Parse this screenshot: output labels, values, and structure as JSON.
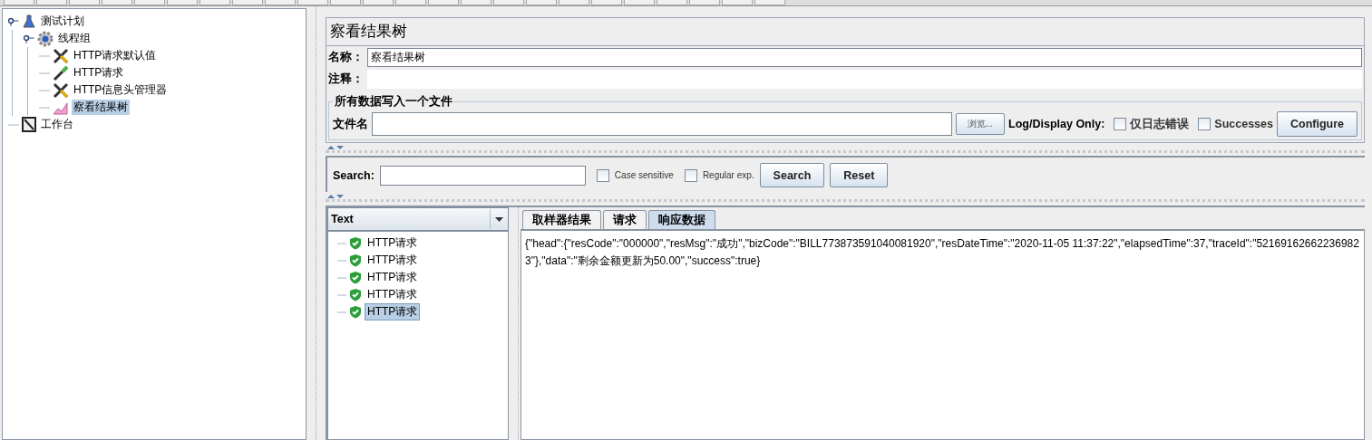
{
  "tree": [
    {
      "label": "测试计划",
      "kind": "plan",
      "selected": false,
      "children": [
        {
          "label": "线程组",
          "kind": "threads",
          "selected": false,
          "children": [
            {
              "label": "HTTP请求默认值",
              "kind": "config",
              "selected": false
            },
            {
              "label": "HTTP请求",
              "kind": "sampler",
              "selected": false
            },
            {
              "label": "HTTP信息头管理器",
              "kind": "config",
              "selected": false
            },
            {
              "label": "察看结果树",
              "kind": "listener",
              "selected": true
            }
          ]
        }
      ]
    },
    {
      "label": "工作台",
      "kind": "workbench",
      "selected": false
    }
  ],
  "panel": {
    "title": "察看结果树",
    "name_label": "名称：",
    "name_value": "察看结果树",
    "comment_label": "注释：",
    "file_group": {
      "legend": "所有数据写入一个文件",
      "file_label": "文件名",
      "browse": "浏览...",
      "log_label": "Log/Display Only:",
      "options": [
        {
          "label": "仅日志错误",
          "checked": false
        },
        {
          "label": "Successes",
          "checked": false
        }
      ],
      "configure": "Configure"
    }
  },
  "search": {
    "label": "Search:",
    "options": [
      {
        "label": "Case sensitive",
        "checked": false
      },
      {
        "label": "Regular exp.",
        "checked": false
      }
    ],
    "search_button": "Search",
    "reset_button": "Reset"
  },
  "renderer": {
    "value": "Text"
  },
  "results": [
    {
      "label": "HTTP请求",
      "success": true,
      "selected": false
    },
    {
      "label": "HTTP请求",
      "success": true,
      "selected": false
    },
    {
      "label": "HTTP请求",
      "success": true,
      "selected": false
    },
    {
      "label": "HTTP请求",
      "success": true,
      "selected": false
    },
    {
      "label": "HTTP请求",
      "success": true,
      "selected": true
    }
  ],
  "tabs": [
    {
      "label": "取样器结果",
      "selected": false
    },
    {
      "label": "请求",
      "selected": false
    },
    {
      "label": "响应数据",
      "selected": true
    }
  ],
  "response": "{\"head\":{\"resCode\":\"000000\",\"resMsg\":\"成功\",\"bizCode\":\"BILL773873591040081920\",\"resDateTime\":\"2020-11-05 11:37:22\",\"elapsedTime\":37,\"traceId\":\"521691626622369823\"},\"data\":\"剩余金额更新为50.00\",\"success\":true}"
}
